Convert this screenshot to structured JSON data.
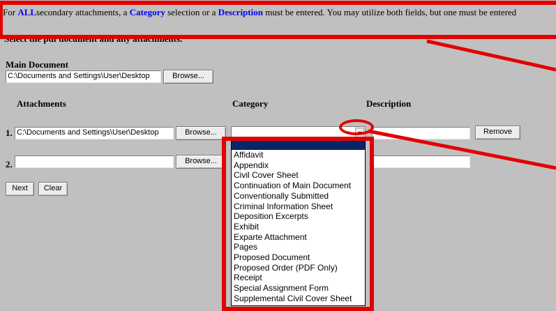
{
  "notice": {
    "prefix": "For ",
    "all": "ALL",
    "part2": "secondary attachments, a ",
    "category": "Category",
    "part3": " selection or a ",
    "description": "Description",
    "part4": " must be entered. You may utilize both fields, but one must be entered"
  },
  "instruction": "Select the pdf document and any attachments.",
  "main_document": {
    "label": "Main Document",
    "path": "C:\\Documents and Settings\\User\\Desktop",
    "browse_label": "Browse..."
  },
  "columns": {
    "attachments": "Attachments",
    "category": "Category",
    "description": "Description"
  },
  "attachments": [
    {
      "number": "1.",
      "path": "C:\\Documents and Settings\\User\\Desktop",
      "browse_label": "Browse...",
      "category": "",
      "description": "",
      "remove_label": "Remove"
    },
    {
      "number": "2.",
      "path": "",
      "browse_label": "Browse...",
      "description": ""
    }
  ],
  "actions": {
    "next_label": "Next",
    "clear_label": "Clear"
  },
  "category_options": [
    "Affidavit",
    "Appendix",
    "Civil Cover Sheet",
    "Continuation of Main Document",
    "Conventionally Submitted",
    "Criminal Information Sheet",
    "Deposition Excerpts",
    "Exhibit",
    "Exparte Attachment",
    "Pages",
    "Proposed Document",
    "Proposed Order (PDF Only)",
    "Receipt",
    "Special Assignment Form",
    "Supplemental Civil Cover Sheet"
  ],
  "colors": {
    "background": "#c0c0c0",
    "highlight": "#e30000",
    "link_blue": "#0000ff",
    "selection": "#0a246a"
  }
}
